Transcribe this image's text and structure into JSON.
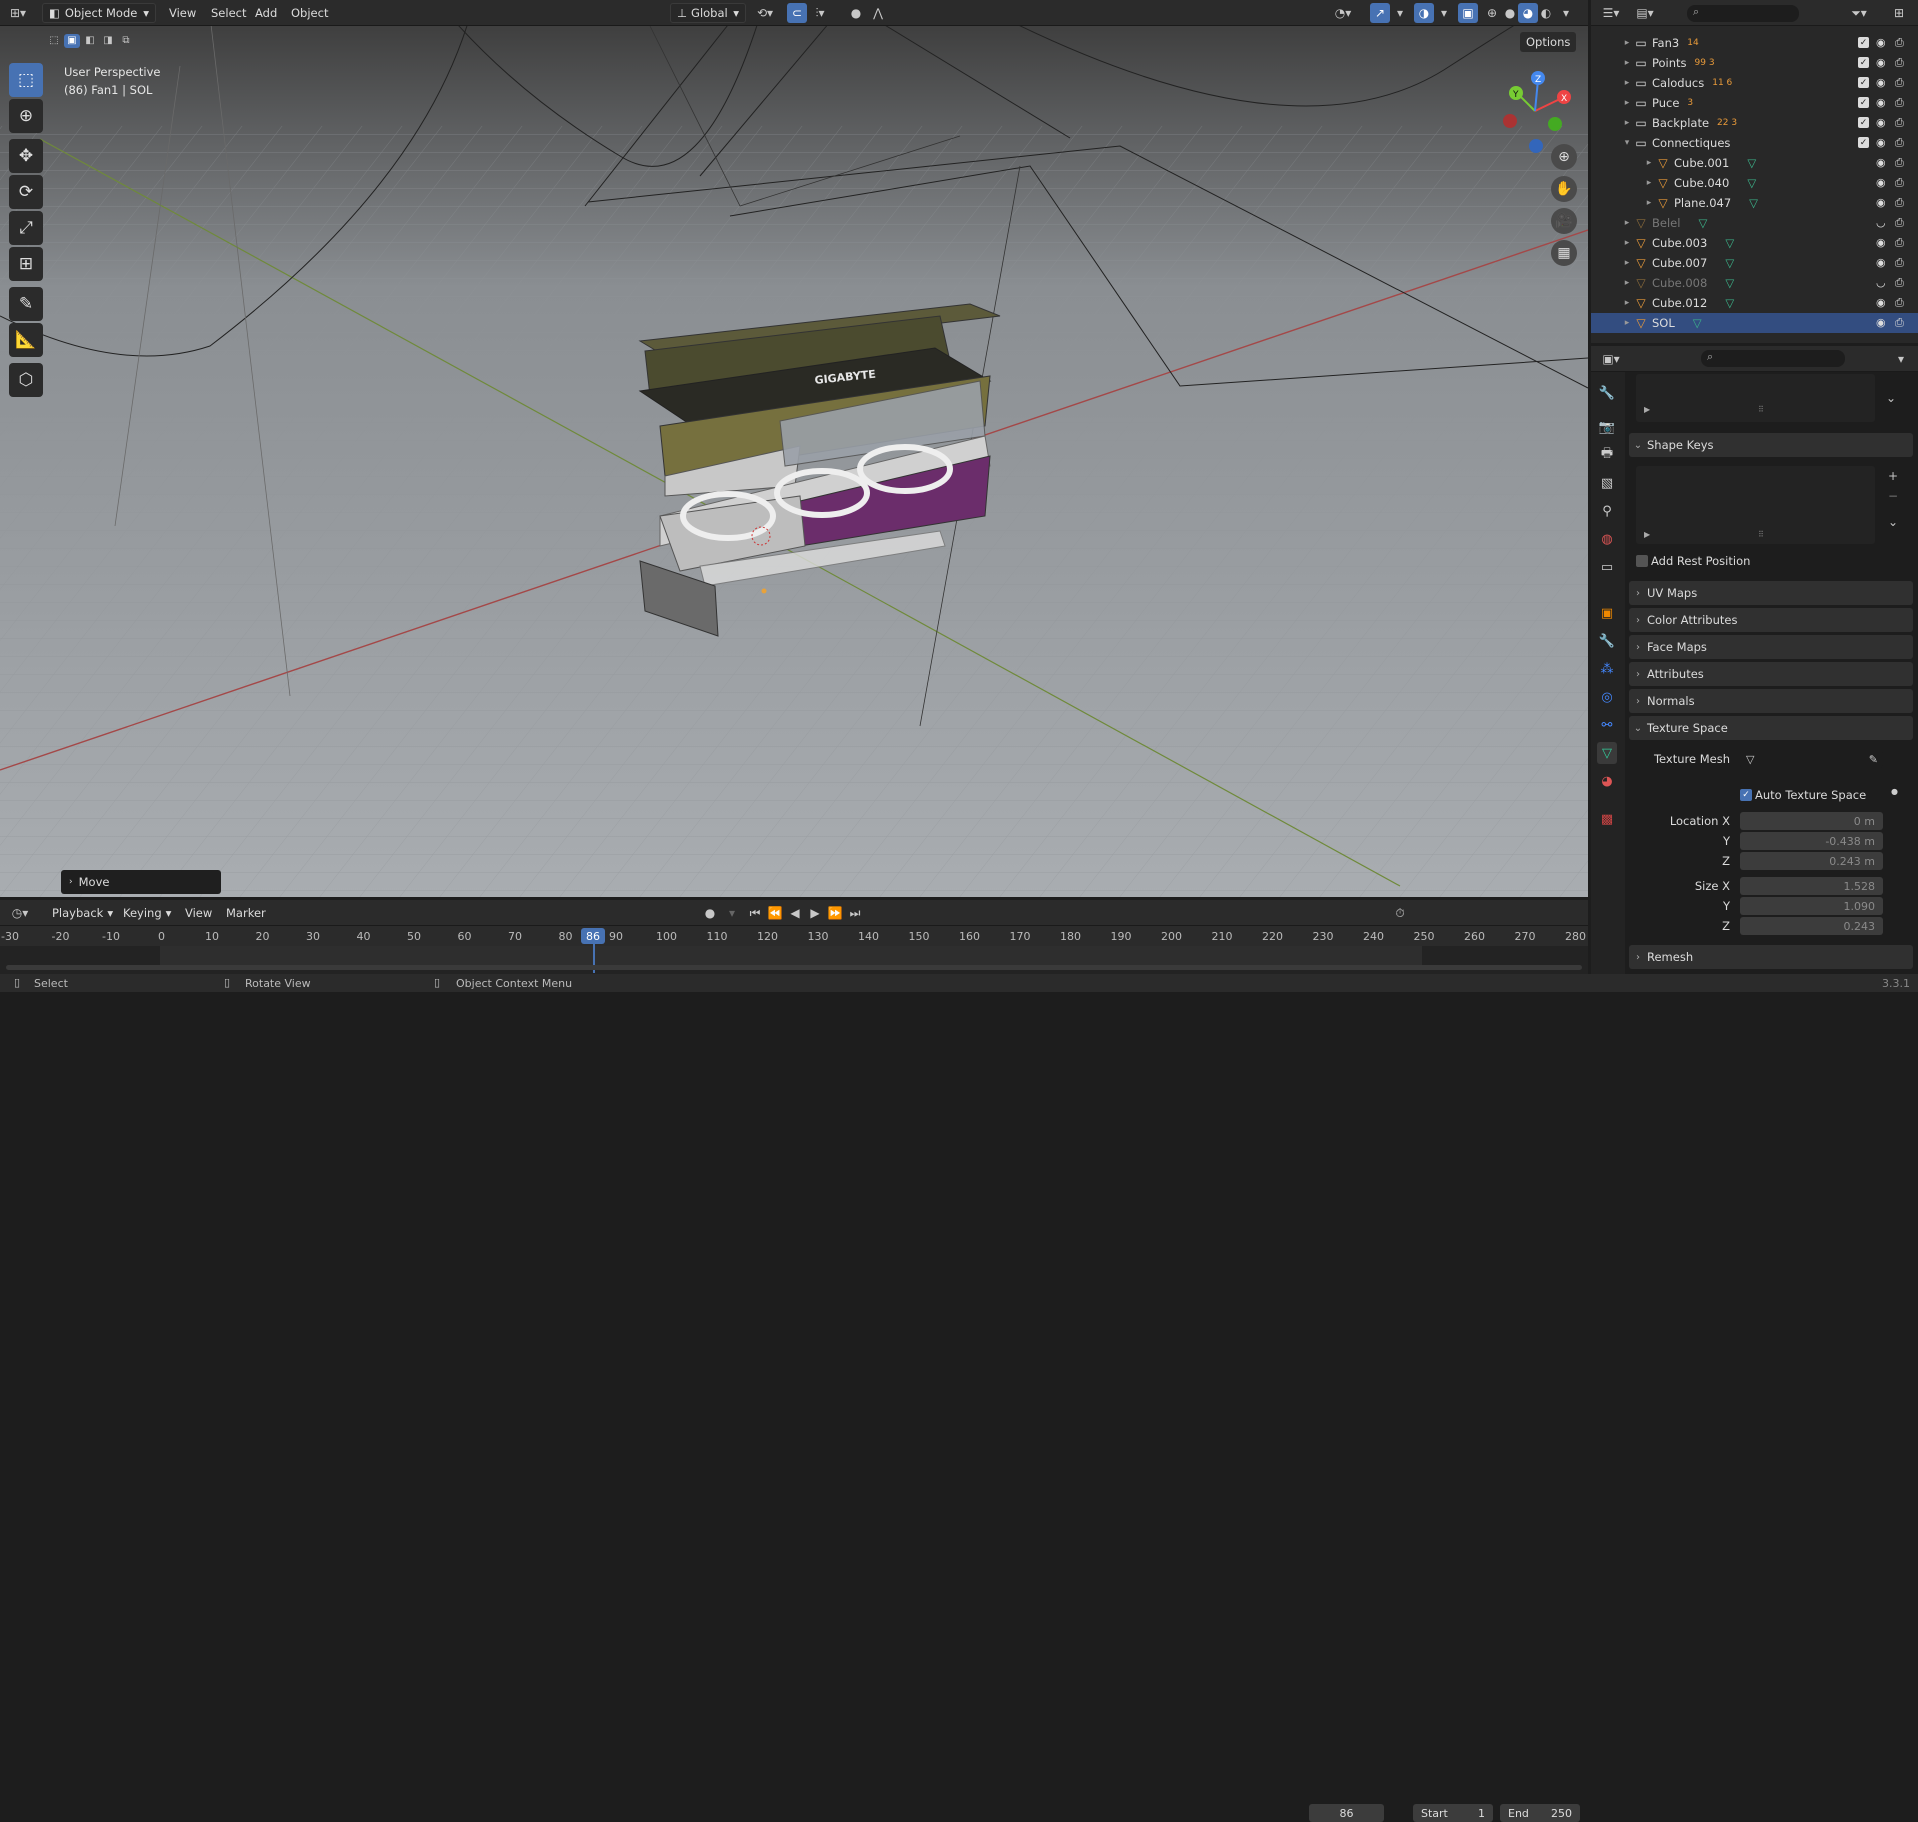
{
  "topbar": {
    "editor_icon": "editor-type-icon",
    "mode": "Object Mode",
    "menu": [
      "View",
      "Select",
      "Add",
      "Object"
    ],
    "orientation": "Global",
    "options": "Options"
  },
  "viewport": {
    "perspective": "User Perspective",
    "object_info": "(86) Fan1 | SOL",
    "gizmo": {
      "x": "X",
      "y": "Y",
      "z": "Z"
    },
    "card_brand": "GIGABYTE",
    "operator": "Move"
  },
  "outliner": {
    "rows": [
      {
        "name": "Fan3",
        "indent": 1,
        "type": "collection",
        "badges": "14",
        "dim": false,
        "sel": false
      },
      {
        "name": "Points",
        "indent": 1,
        "type": "collection",
        "badges": "99 3",
        "dim": false,
        "sel": false
      },
      {
        "name": "Caloducs",
        "indent": 1,
        "type": "collection",
        "badges": "11 6",
        "dim": false,
        "sel": false
      },
      {
        "name": "Puce",
        "indent": 1,
        "type": "collection",
        "badges": "3",
        "dim": false,
        "sel": false
      },
      {
        "name": "Backplate",
        "indent": 1,
        "type": "collection",
        "badges": "22 3",
        "dim": false,
        "sel": false
      },
      {
        "name": "Connectiques",
        "indent": 1,
        "type": "collection",
        "badges": "",
        "dim": false,
        "sel": false
      },
      {
        "name": "Cube.001",
        "indent": 2,
        "type": "mesh",
        "badges": "",
        "dim": false,
        "sel": false
      },
      {
        "name": "Cube.040",
        "indent": 2,
        "type": "mesh",
        "badges": "",
        "dim": false,
        "sel": false
      },
      {
        "name": "Plane.047",
        "indent": 2,
        "type": "mesh",
        "badges": "",
        "dim": false,
        "sel": false
      },
      {
        "name": "Belel",
        "indent": 1,
        "type": "mesh",
        "badges": "",
        "dim": true,
        "sel": false
      },
      {
        "name": "Cube.003",
        "indent": 1,
        "type": "mesh",
        "badges": "",
        "dim": false,
        "sel": false
      },
      {
        "name": "Cube.007",
        "indent": 1,
        "type": "mesh",
        "badges": "",
        "dim": false,
        "sel": false
      },
      {
        "name": "Cube.008",
        "indent": 1,
        "type": "mesh",
        "badges": "",
        "dim": true,
        "sel": false
      },
      {
        "name": "Cube.012",
        "indent": 1,
        "type": "mesh",
        "badges": "",
        "dim": false,
        "sel": false
      },
      {
        "name": "SOL",
        "indent": 1,
        "type": "mesh",
        "badges": "",
        "dim": false,
        "sel": true
      }
    ]
  },
  "properties": {
    "shape_keys": "Shape Keys",
    "add_rest": "Add Rest Position",
    "uv_maps": "UV Maps",
    "color_attributes": "Color Attributes",
    "face_maps": "Face Maps",
    "attributes": "Attributes",
    "normals": "Normals",
    "texture_space": "Texture Space",
    "texture_mesh": "Texture Mesh",
    "auto_texture": "Auto Texture Space",
    "location_x_label": "Location X",
    "y_label": "Y",
    "z_label": "Z",
    "size_x_label": "Size X",
    "loc_x": "0 m",
    "loc_y": "-0.438 m",
    "loc_z": "0.243 m",
    "size_x": "1.528",
    "size_y": "1.090",
    "size_z": "0.243",
    "remesh": "Remesh"
  },
  "timeline": {
    "menu": [
      "Playback",
      "Keying",
      "View",
      "Marker"
    ],
    "current_frame": "86",
    "start_label": "Start",
    "start": "1",
    "end_label": "End",
    "end": "250",
    "ticks": [
      "-30",
      "-20",
      "-10",
      "0",
      "10",
      "20",
      "30",
      "40",
      "50",
      "60",
      "70",
      "80",
      "90",
      "100",
      "110",
      "120",
      "130",
      "140",
      "150",
      "160",
      "170",
      "180",
      "190",
      "200",
      "210",
      "220",
      "230",
      "240",
      "250",
      "260",
      "270",
      "280"
    ]
  },
  "status": {
    "select": "Select",
    "rotate": "Rotate View",
    "context": "Object Context Menu",
    "version": "3.3.1"
  }
}
